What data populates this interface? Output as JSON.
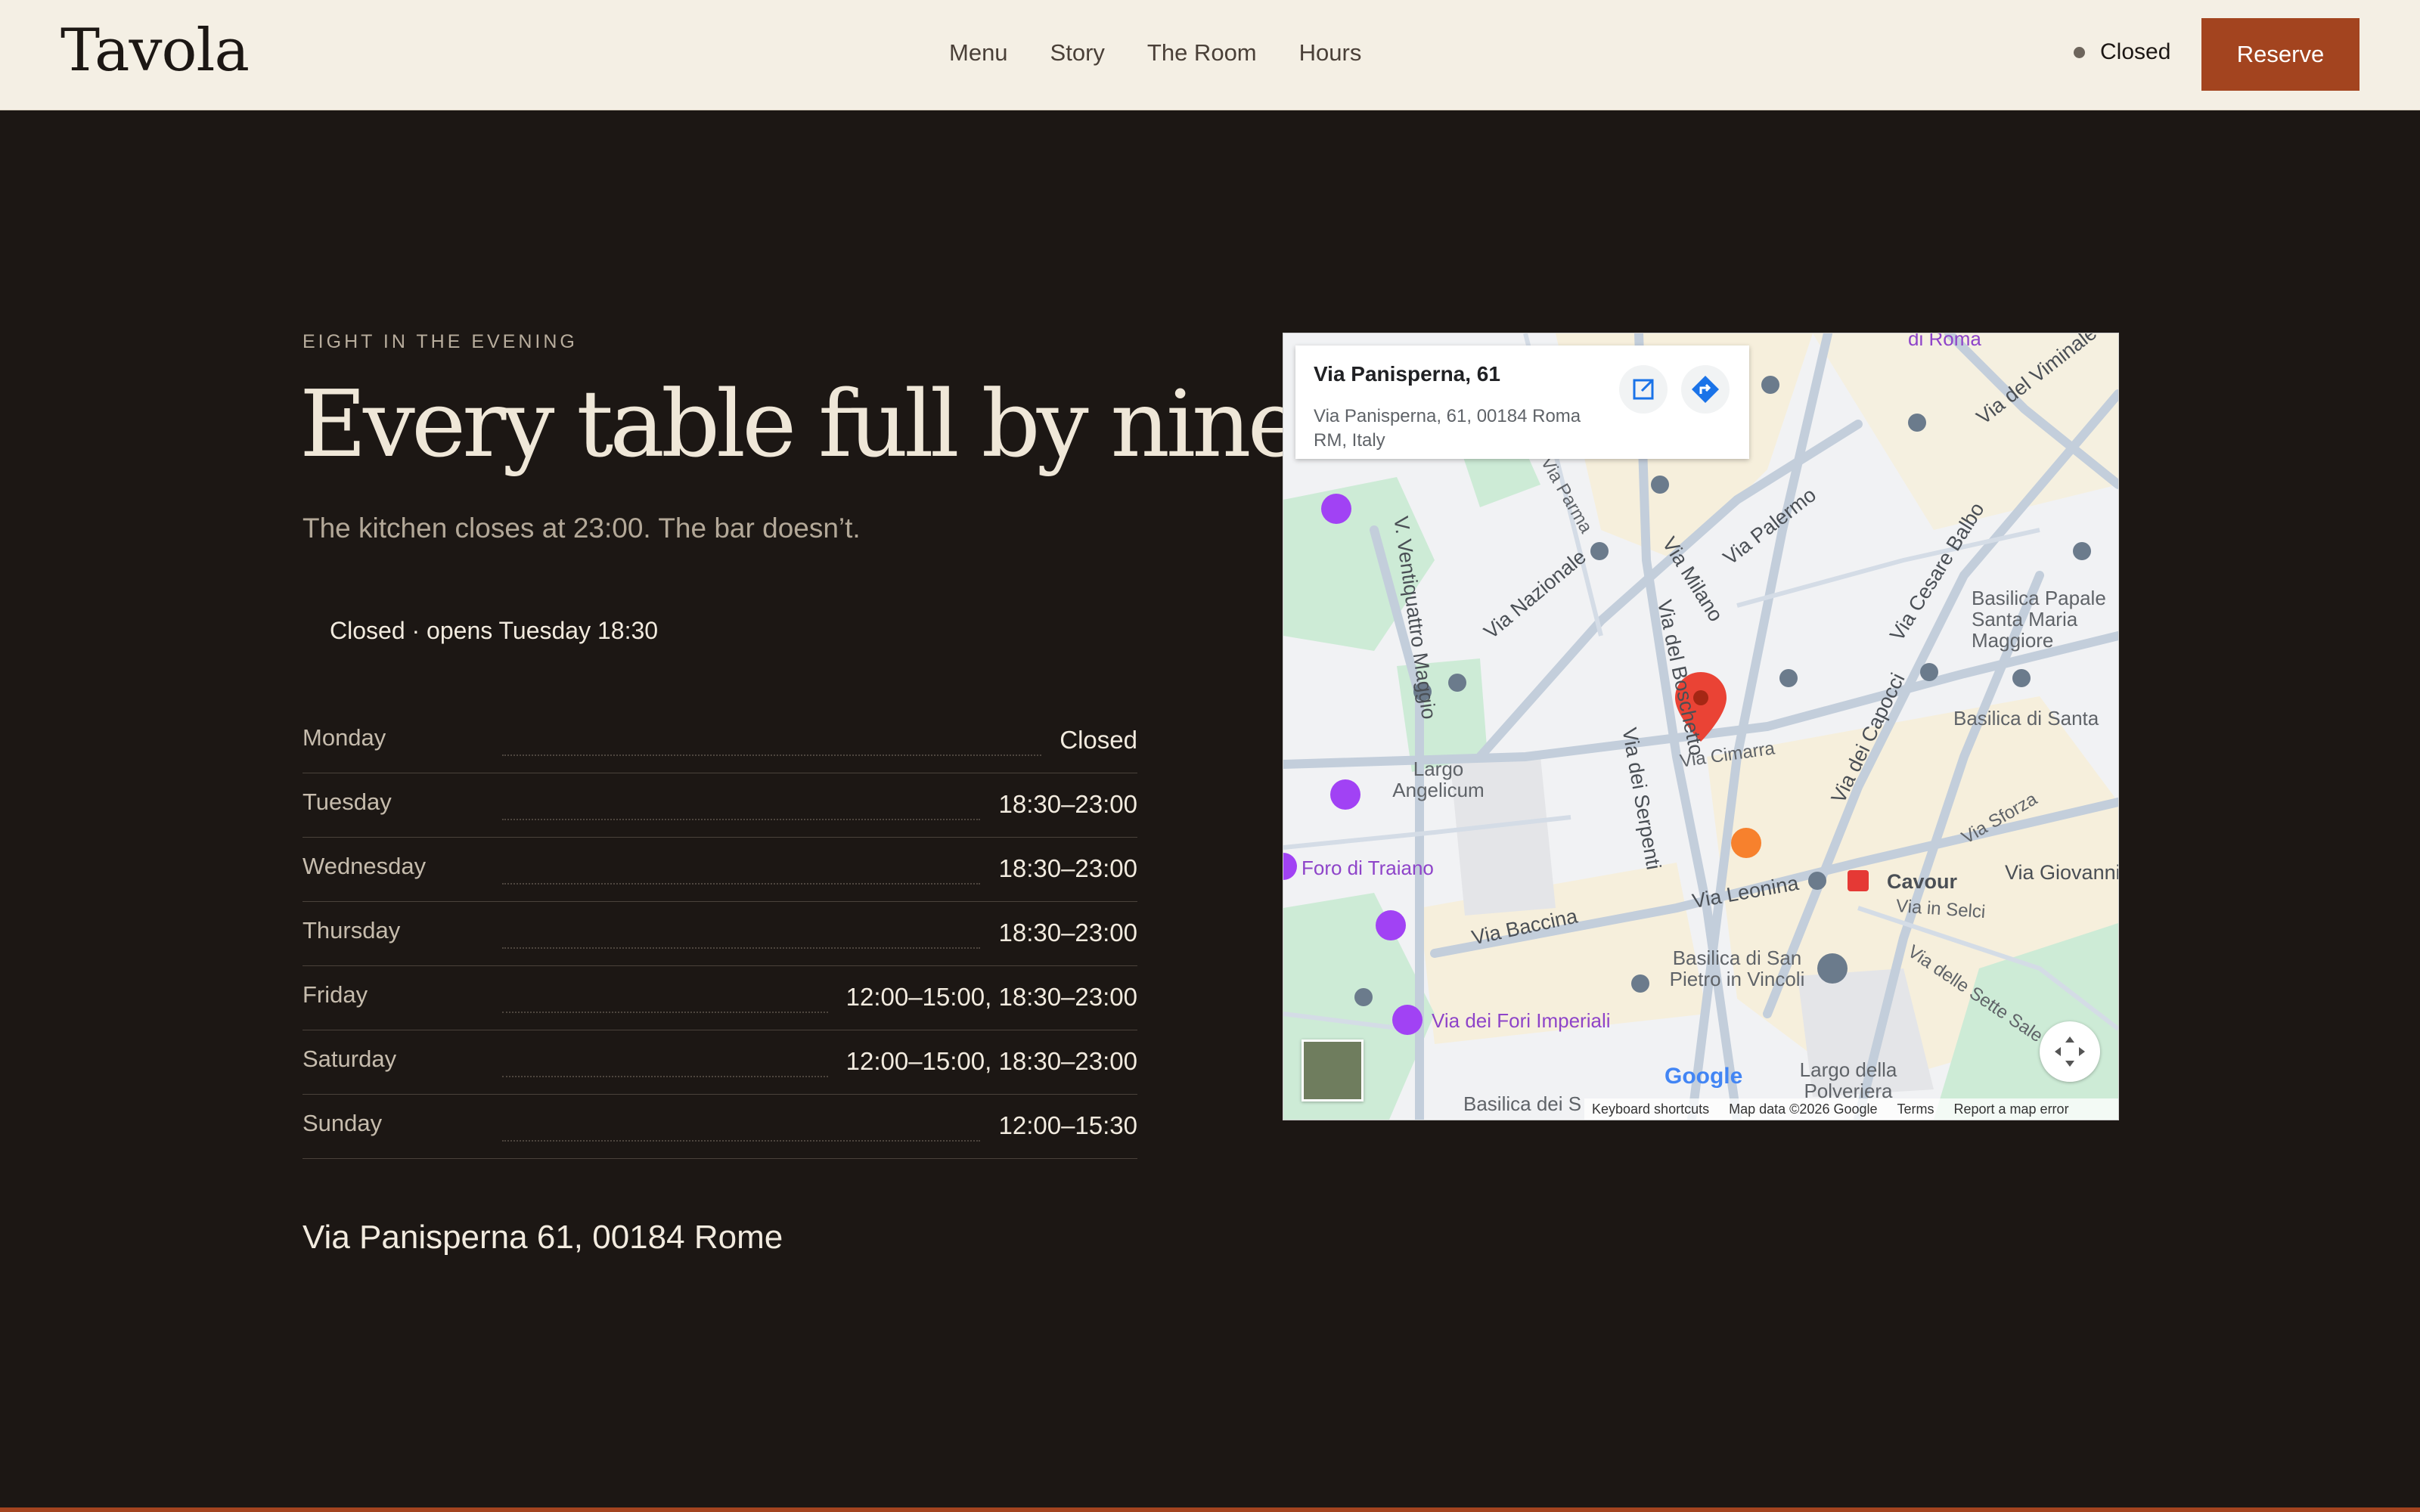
{
  "header": {
    "logo": "Tavola",
    "nav": [
      "Menu",
      "Story",
      "The Room",
      "Hours"
    ],
    "status": "Closed",
    "reserve_label": "Reserve"
  },
  "hero": {
    "eyebrow": "EIGHT IN THE EVENING",
    "headline": "Every table full by nine.",
    "subtitle": "The kitchen closes at 23:00. The bar doesn’t.",
    "today_status": "Closed · opens Tuesday 18:30"
  },
  "hours": [
    {
      "day": "Monday",
      "time": "Closed"
    },
    {
      "day": "Tuesday",
      "time": "18:30–23:00"
    },
    {
      "day": "Wednesday",
      "time": "18:30–23:00"
    },
    {
      "day": "Thursday",
      "time": "18:30–23:00"
    },
    {
      "day": "Friday",
      "time": "12:00–15:00, 18:30–23:00"
    },
    {
      "day": "Saturday",
      "time": "12:00–15:00, 18:30–23:00"
    },
    {
      "day": "Sunday",
      "time": "12:00–15:30"
    }
  ],
  "address": "Via Panisperna 61, 00184 Rome",
  "map": {
    "place_name": "Via Panisperna, 61",
    "place_address": "Via Panisperna, 61, 00184 Roma RM, Italy",
    "google": "Google",
    "attribution": [
      "Keyboard shortcuts",
      "Map data ©2026 Google",
      "Terms",
      "Report a map error"
    ],
    "labels": {
      "l1": "Via Parma",
      "l2": "V. Ventiquattro Maggio",
      "l3": "Via Nazionale",
      "l4": "Via Milano",
      "l5": "Via Palermo",
      "l6": "Via del Boschetto",
      "l7": "Via Cesare Balbo",
      "l8": "Via del Viminale",
      "l9": "Basilica Papale Santa Maria Maggiore",
      "l10": "Basilica di Santa",
      "l11": "Via Cimarra",
      "l12": "Largo Angelicum",
      "l13": "Via dei Serpenti",
      "l14": "Via dei Capocci",
      "l15": "Via Sforza",
      "l16": "Foro di Traiano",
      "l17": "Via Baccina",
      "l18": "Via Leonina",
      "l19": "Cavour",
      "l20": "Via Giovanni Lanza",
      "l21": "Via in Selci",
      "l22": "Basilica di San Pietro in Vincoli",
      "l23": "Via delle Sette Sale",
      "l24": "Via dei Fori Imperiali",
      "l25": "Largo della Polveriera",
      "l26": "Basilica dei S",
      "l27": "di Roma"
    }
  },
  "colors": {
    "accent": "#a3441f",
    "background": "#1c1714",
    "header": "#f4efe4"
  }
}
